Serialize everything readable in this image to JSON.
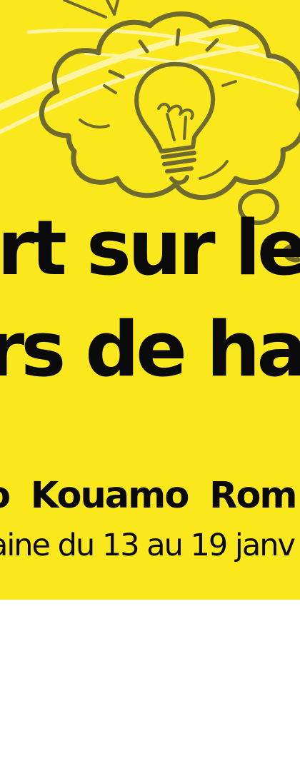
{
  "banner": {
    "background_color": "#fbe81c",
    "ink_color": "#0a0a0a",
    "illustration_color": "#6f6a2e",
    "illustration_icons": [
      "thought-cloud-icon",
      "light-bulb-icon"
    ],
    "title_line_1": "rt sur le",
    "title_line_2": "rs de ha",
    "author": "o Kouamo  Rom",
    "dates": "aine du 13 au 19 janv"
  }
}
